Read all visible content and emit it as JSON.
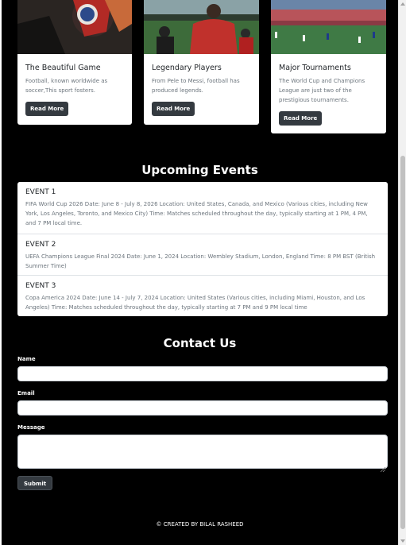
{
  "cards": [
    {
      "title": "The Beautiful Game",
      "text": "Football, known worldwide as soccer,This sport fosters.",
      "button": "Read More",
      "image": "football-closeup-image"
    },
    {
      "title": "Legendary Players",
      "text": "From Pele to Messi, football has produced legends.",
      "button": "Read More",
      "image": "players-stadium-image"
    },
    {
      "title": "Major Tournaments",
      "text": "The World Cup and Champions League are just two of the prestigious tournaments.",
      "button": "Read More",
      "image": "stadium-crowd-image"
    }
  ],
  "events_section": {
    "title": "Upcoming Events",
    "events": [
      {
        "title": "EVENT 1",
        "description": "FIFA World Cup 2026 Date: June 8 - July 8, 2026 Location: United States, Canada, and Mexico (Various cities, including New York, Los Angeles, Toronto, and Mexico City) Time: Matches scheduled throughout the day, typically starting at 1 PM, 4 PM, and 7 PM local time."
      },
      {
        "title": "EVENT 2",
        "description": "UEFA Champions League Final 2024 Date: June 1, 2024 Location: Wembley Stadium, London, England Time: 8 PM BST (British Summer Time)"
      },
      {
        "title": "EVENT 3",
        "description": "Copa America 2024 Date: June 14 - July 7, 2024 Location: United States (Various cities, including Miami, Houston, and Los Angeles) Time: Matches scheduled throughout the day, typically starting at 7 PM and 9 PM local time"
      }
    ]
  },
  "contact": {
    "title": "Contact Us",
    "name_label": "Name",
    "email_label": "Email",
    "message_label": "Message",
    "name_value": "",
    "email_value": "",
    "message_value": "",
    "submit_label": "Submit"
  },
  "footer": {
    "text": "© CREATED BY BILAL RASHEED"
  },
  "colors": {
    "page_background": "#000000",
    "button_background": "#343a40",
    "card_background": "#ffffff"
  }
}
